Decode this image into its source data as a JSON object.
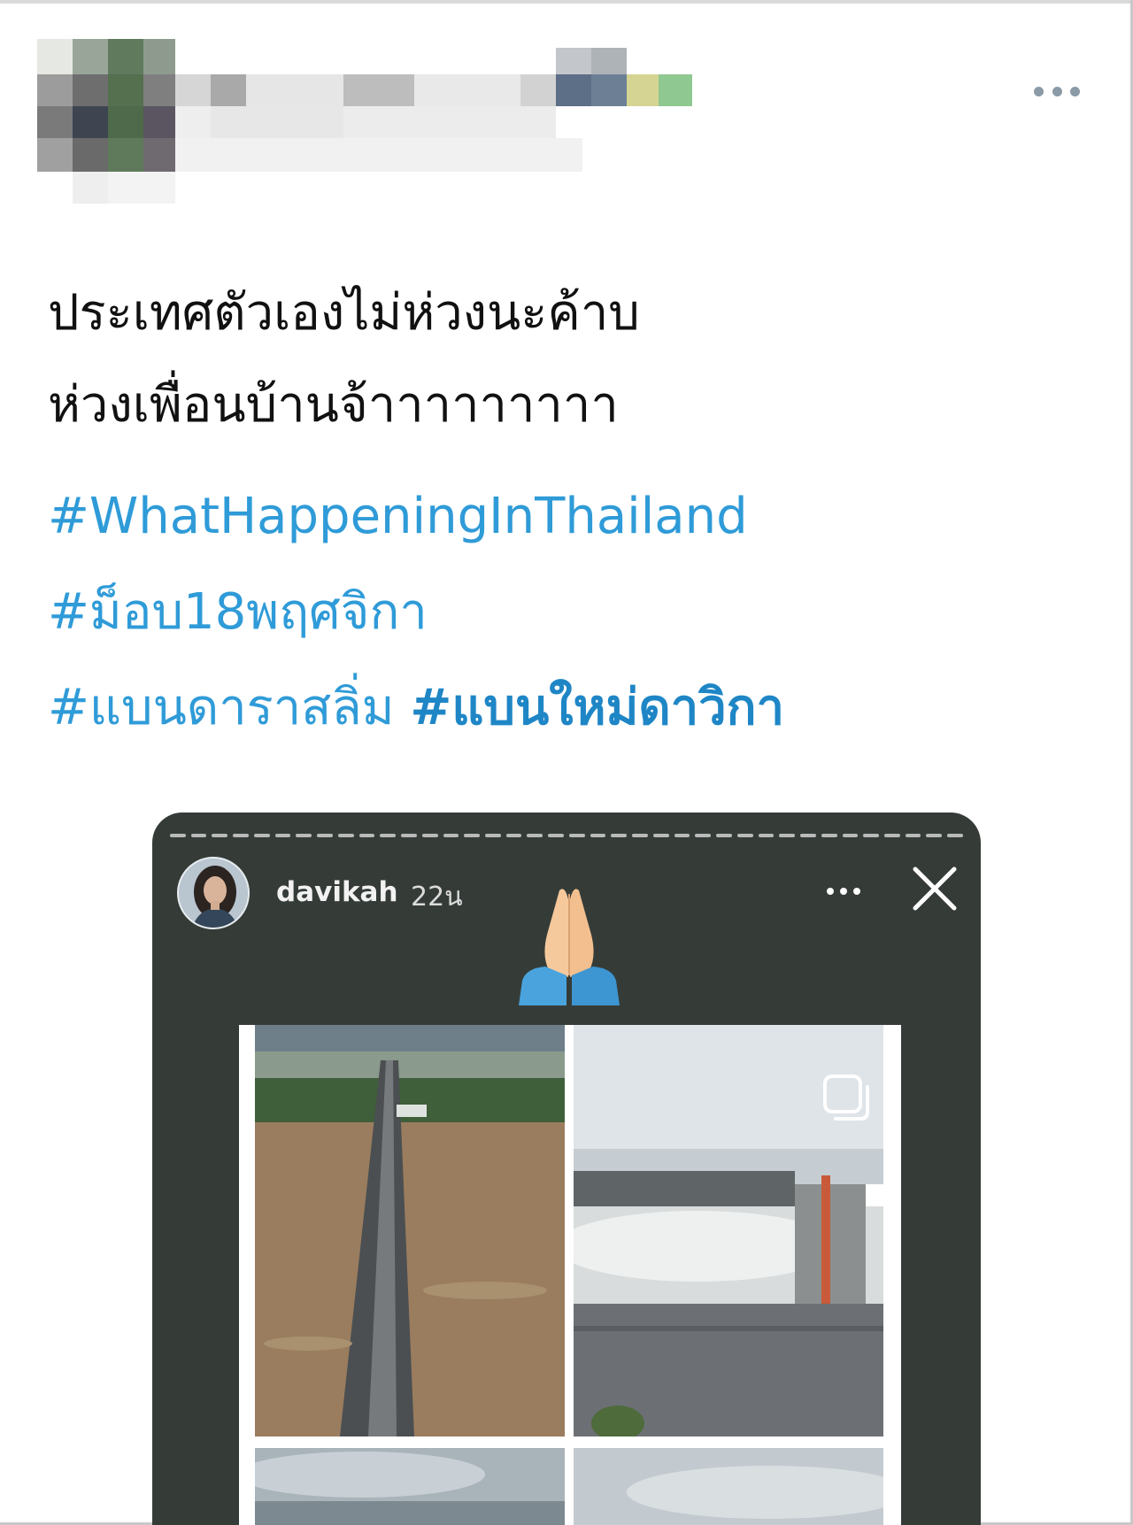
{
  "tweet": {
    "more_icon": "more-horizontal-icon",
    "text_lines": [
      "ประเทศตัวเองไม่ห่วงนะค้าบ",
      "ห่วงเพื่อนบ้านจ้าาาาาาาาา"
    ],
    "hashtags": [
      "#WhatHappeningInThailand",
      "#ม็อบ18พฤศจิกา",
      "#แบนดาราสลิ่ม",
      "#แบนใหม่ดาวิกา"
    ]
  },
  "story": {
    "username": "davikah",
    "time": "22น",
    "more_icon": "more-horizontal-icon",
    "close_icon": "close-icon",
    "emoji": "folded-hands-emoji",
    "multi_image_icon": "multiple-images-icon",
    "colors": {
      "background": "#353c38",
      "hashtag": "#2f9bd8"
    }
  }
}
